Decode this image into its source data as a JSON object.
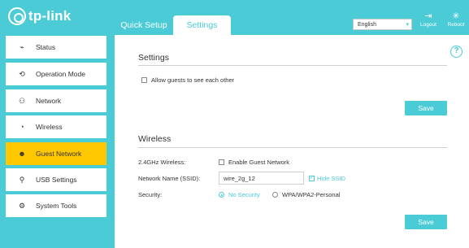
{
  "header": {
    "brand": "tp-link",
    "tabs": [
      {
        "label": "Quick Setup",
        "active": false
      },
      {
        "label": "Settings",
        "active": true
      }
    ],
    "language": "English",
    "logout_label": "Logout",
    "reboot_label": "Reboot"
  },
  "sidebar": {
    "items": [
      {
        "label": "Status",
        "icon": "pulse-icon"
      },
      {
        "label": "Operation Mode",
        "icon": "cycle-icon"
      },
      {
        "label": "Network",
        "icon": "network-icon"
      },
      {
        "label": "Wireless",
        "icon": "wifi-icon"
      },
      {
        "label": "Guest Network",
        "icon": "guests-icon",
        "active": true
      },
      {
        "label": "USB Settings",
        "icon": "usb-icon"
      },
      {
        "label": "System Tools",
        "icon": "gear-icon"
      }
    ]
  },
  "settings_section": {
    "title": "Settings",
    "allow_guests_label": "Allow guests to see each other",
    "allow_guests_checked": false,
    "save_label": "Save"
  },
  "wireless_section": {
    "title": "Wireless",
    "band_label": "2.4GHz Wireless:",
    "enable_label": "Enable Guest Network",
    "enable_checked": false,
    "ssid_label": "Network Name (SSID):",
    "ssid_value": "wire_2g_12",
    "hide_ssid_label": "Hide SSID",
    "hide_ssid_checked": true,
    "security_label": "Security:",
    "security_options": [
      "No Security",
      "WPA/WPA2-Personal"
    ],
    "security_selected": "No Security",
    "save_label": "Save"
  },
  "colors": {
    "accent": "#4acbd6",
    "active_nav": "#ffc800"
  }
}
